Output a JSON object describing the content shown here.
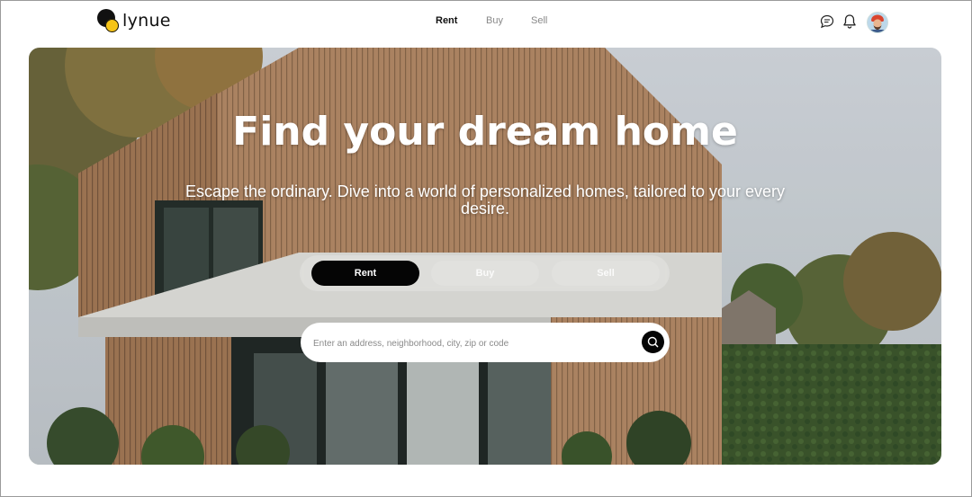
{
  "header": {
    "logo_text": "lynue",
    "nav": [
      {
        "label": "Rent",
        "active": true
      },
      {
        "label": "Buy",
        "active": false
      },
      {
        "label": "Sell",
        "active": false
      }
    ],
    "icons": [
      "chat-icon",
      "bell-icon",
      "avatar"
    ]
  },
  "hero": {
    "title": "Find your dream home",
    "subtitle": "Escape the ordinary. Dive into a world of personalized homes, tailored to your every desire.",
    "tabs": {
      "rent": "Rent",
      "buy": "Buy",
      "sell": "Sell",
      "selected": "Rent"
    },
    "search": {
      "placeholder": "Enter an address, neighborhood, city, zip or code",
      "value": ""
    }
  },
  "colors": {
    "accent": "#050505",
    "logo_yellow": "#f6c417",
    "nav_active": "#111111",
    "nav_inactive": "#888888"
  }
}
